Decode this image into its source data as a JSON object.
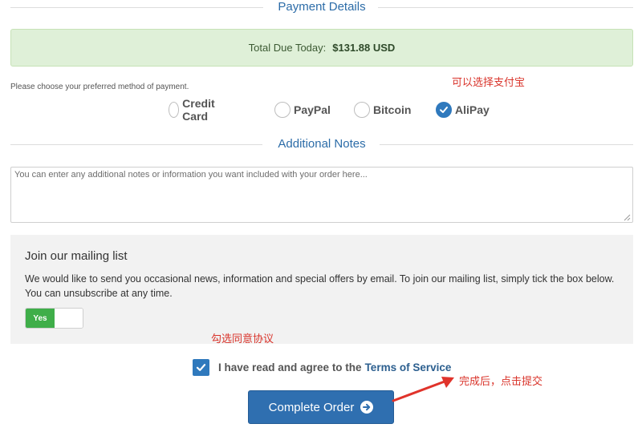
{
  "payment_section": {
    "title": "Payment Details"
  },
  "total": {
    "label": "Total Due Today:",
    "amount": "$131.88 USD"
  },
  "annotations": {
    "alipay_note": "可以选择支付宝",
    "agree_note": "勾选同意协议",
    "submit_note": "完成后，点击提交"
  },
  "payment_methods": {
    "prompt": "Please choose your preferred method of payment.",
    "options": [
      {
        "label": "Credit Card",
        "checked": false
      },
      {
        "label": "PayPal",
        "checked": false
      },
      {
        "label": "Bitcoin",
        "checked": false
      },
      {
        "label": "AliPay",
        "checked": true
      }
    ]
  },
  "notes_section": {
    "title": "Additional Notes",
    "placeholder": "You can enter any additional notes or information you want included with your order here...",
    "value": ""
  },
  "mailing": {
    "heading": "Join our mailing list",
    "description": "We would like to send you occasional news, information and special offers by email. To join our mailing list, simply tick the box below. You can unsubscribe at any time.",
    "toggle_label": "Yes",
    "toggle_on": true
  },
  "agree": {
    "text": "I have read and agree to the",
    "link": "Terms of Service",
    "checked": true
  },
  "submit": {
    "label": "Complete Order"
  },
  "colors": {
    "accent": "#2f79bd",
    "success_bg": "#dff0d8",
    "toggle_on": "#3fae49",
    "annotation": "#d9342b"
  }
}
